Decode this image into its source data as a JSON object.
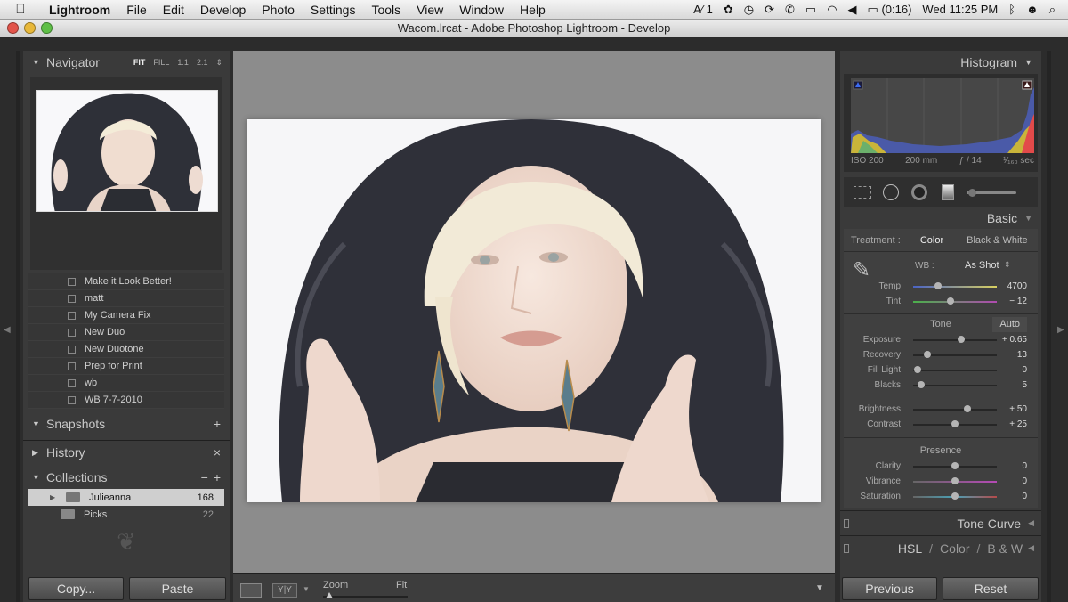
{
  "menubar": {
    "apple": "",
    "app_name": "Lightroom",
    "menus": [
      "File",
      "Edit",
      "Develop",
      "Photo",
      "Settings",
      "Tools",
      "View",
      "Window",
      "Help"
    ],
    "status": {
      "adobe": "1",
      "battery": "(0:16)",
      "clock": "Wed 11:25 PM"
    }
  },
  "window": {
    "title": "Wacom.lrcat - Adobe Photoshop Lightroom - Develop"
  },
  "left_panel": {
    "navigator": {
      "title": "Navigator",
      "zoom_options": [
        "FIT",
        "FILL",
        "1:1",
        "2:1"
      ],
      "selected_zoom": "FIT"
    },
    "presets": [
      "Make it Look Better!",
      "matt",
      "My Camera Fix",
      "New Duo",
      "New Duotone",
      "Prep for Print",
      "wb",
      "WB 7-7-2010"
    ],
    "snapshots": {
      "title": "Snapshots",
      "action": "+"
    },
    "history": {
      "title": "History",
      "action": "×"
    },
    "collections": {
      "title": "Collections",
      "actions": [
        "−",
        "+"
      ],
      "items": [
        {
          "name": "Julieanna",
          "count": "168",
          "selected": true
        },
        {
          "name": "Picks",
          "count": "22",
          "selected": false
        }
      ]
    },
    "copy_button": "Copy...",
    "paste_button": "Paste"
  },
  "toolbar": {
    "zoom_label": "Zoom",
    "fit_label": "Fit"
  },
  "right_panel": {
    "histogram": {
      "title": "Histogram",
      "iso": "ISO 200",
      "focal": "200 mm",
      "aperture": "ƒ / 14",
      "shutter": "¹⁄₁₆₀ sec"
    },
    "basic": {
      "title": "Basic",
      "treatment_label": "Treatment :",
      "treatment_color": "Color",
      "treatment_bw": "Black & White",
      "wb_label": "WB :",
      "wb_value": "As Shot",
      "wb_sliders": [
        {
          "label": "Temp",
          "value": "4700",
          "pos": 0.3
        },
        {
          "label": "Tint",
          "value": "− 12",
          "pos": 0.45
        }
      ],
      "tone_label": "Tone",
      "auto_label": "Auto",
      "tone_sliders": [
        {
          "label": "Exposure",
          "value": "+ 0.65",
          "pos": 0.57
        },
        {
          "label": "Recovery",
          "value": "13",
          "pos": 0.17
        },
        {
          "label": "Fill Light",
          "value": "0",
          "pos": 0.05
        },
        {
          "label": "Blacks",
          "value": "5",
          "pos": 0.1
        }
      ],
      "tone_sliders_2": [
        {
          "label": "Brightness",
          "value": "+ 50",
          "pos": 0.65
        },
        {
          "label": "Contrast",
          "value": "+ 25",
          "pos": 0.5
        }
      ],
      "presence_label": "Presence",
      "presence_sliders": [
        {
          "label": "Clarity",
          "value": "0",
          "pos": 0.5
        },
        {
          "label": "Vibrance",
          "value": "0",
          "pos": 0.5
        },
        {
          "label": "Saturation",
          "value": "0",
          "pos": 0.5
        }
      ]
    },
    "tone_curve": "Tone Curve",
    "hsl": "HSL",
    "color": "Color",
    "bw": "B & W",
    "previous_button": "Previous",
    "reset_button": "Reset"
  }
}
